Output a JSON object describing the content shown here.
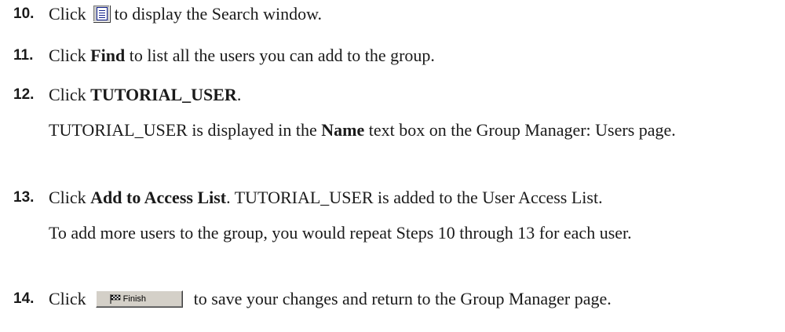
{
  "steps": [
    {
      "number": "10.",
      "before": "Click",
      "icon": "search-window-icon",
      "after": "to display the Search window."
    },
    {
      "number": "11.",
      "before": "Click ",
      "bold": "Find",
      "after": " to list all the users you can add to the group."
    },
    {
      "number": "12.",
      "before": "Click ",
      "bold": "TUTORIAL_USER",
      "after": ".",
      "note": {
        "before": "TUTORIAL_USER is displayed in the ",
        "bold": "Name",
        "after": " text box on the Group Manager: Users page."
      }
    },
    {
      "number": "13.",
      "before": "Click ",
      "bold": "Add to Access List",
      "after": ". TUTORIAL_USER is added to the User Access List.",
      "note": {
        "text": "To add more users to the group, you would repeat Steps 10 through 13 for each user."
      }
    },
    {
      "number": "14.",
      "before": "Click",
      "button": {
        "label": "Finish",
        "icon": "checkered-flag-icon"
      },
      "after": "to save your changes and return to the Group Manager page."
    }
  ]
}
